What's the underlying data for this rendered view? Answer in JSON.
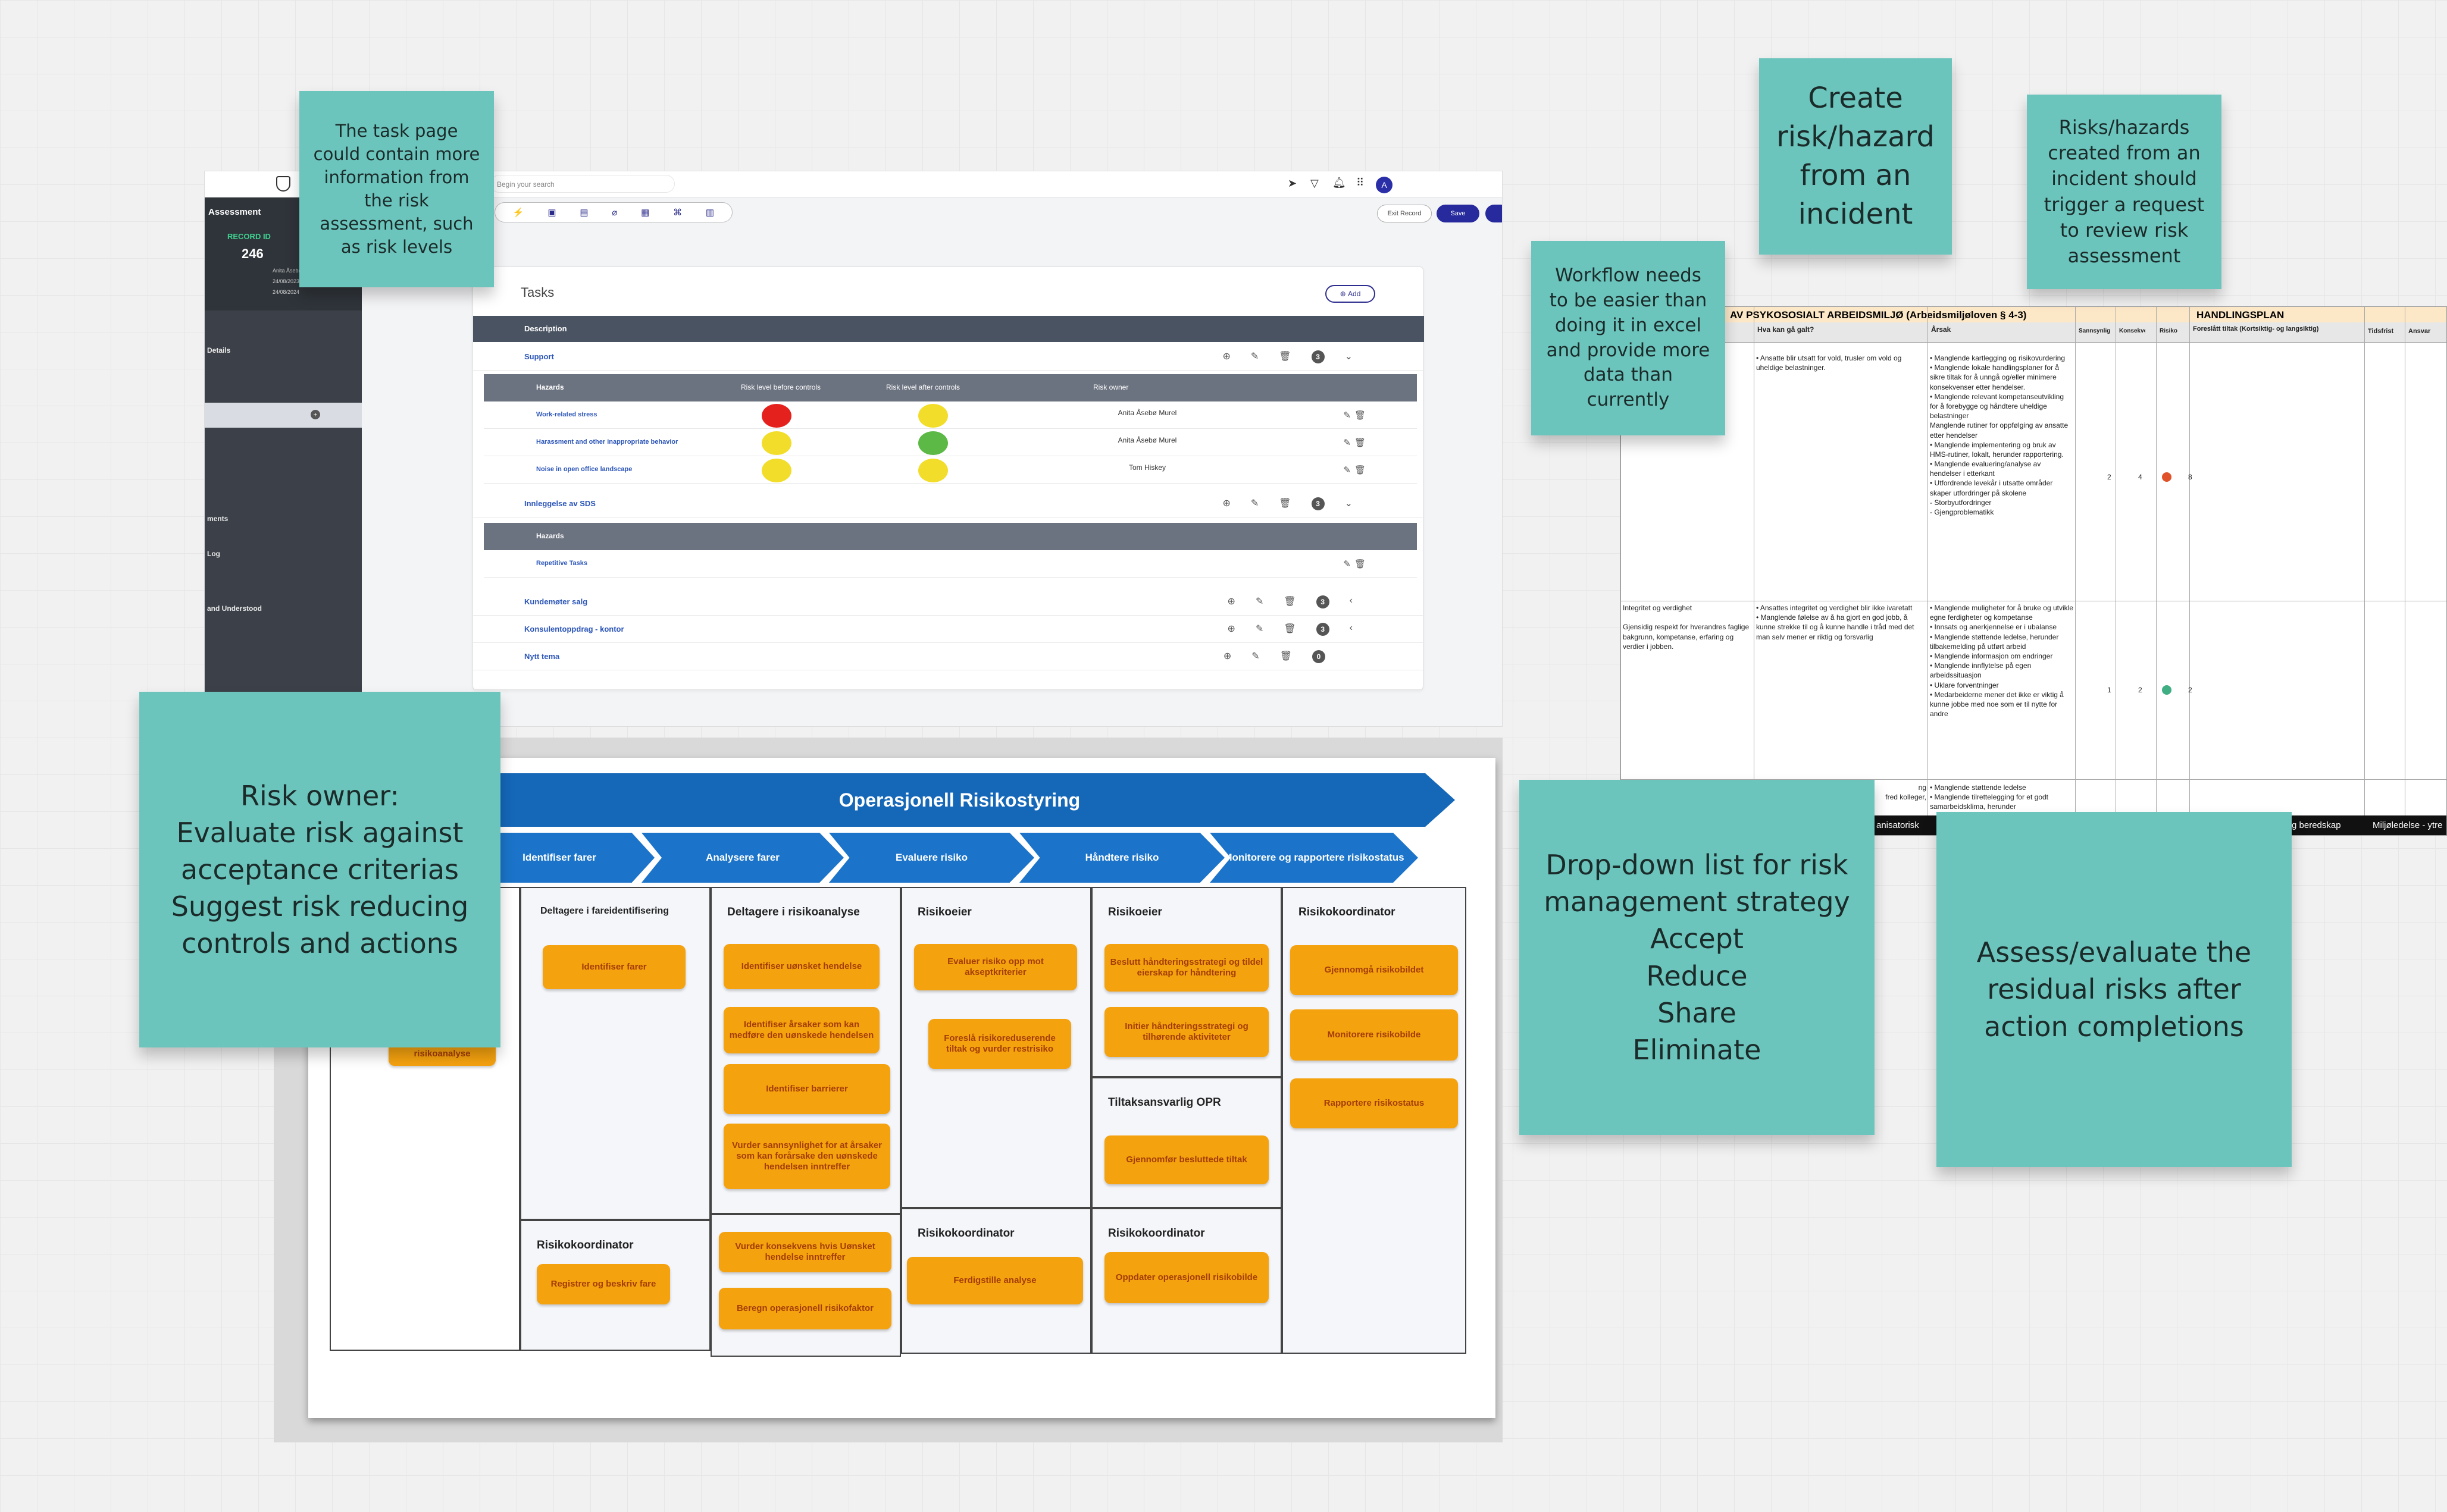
{
  "notes": {
    "task_page": "The task page could contain more information from the risk assessment, such as risk levels",
    "create_risk": "Create risk/hazard from an incident",
    "trigger_review": "Risks/hazards created from an incident should trigger a request to review risk assessment",
    "workflow": "Workflow needs to be easier than doing it in excel and provide more data than currently",
    "risk_owner": "Risk owner:\nEvaluate risk against acceptance criterias\nSuggest risk reducing controls and actions",
    "dropdown": "Drop-down list for risk management strategy\nAccept\nReduce\nShare\nEliminate",
    "assess": "Assess/evaluate the residual risks after action completions"
  },
  "app": {
    "search_placeholder": "Begin your search",
    "avatar": "A",
    "sidebar": {
      "title": "Assessment",
      "record_label": "RECORD ID",
      "record_id": "246",
      "owner": "Anita Åsebø Murel",
      "date1": "24/08/2023",
      "date2": "24/08/2024",
      "labels": [
        "Details",
        "ments",
        "Log",
        "and Understood"
      ]
    },
    "exit_label": "Exit Record",
    "save_label": "Save",
    "tasks_title": "Tasks",
    "add_label": "Add",
    "desc_header": "Description",
    "rows": [
      {
        "name": "Support"
      },
      {
        "name": "Innleggelse av SDS"
      },
      {
        "name": "Kundemøter salg"
      },
      {
        "name": "Konsulentoppdrag - kontor"
      },
      {
        "name": "Nytt tema"
      }
    ],
    "hazard_headers": {
      "hazards": "Hazards",
      "before": "Risk level before controls",
      "after": "Risk level after controls",
      "owner": "Risk owner"
    },
    "hazards": [
      {
        "name": "Work-related stress",
        "before": "#e5211d",
        "after": "#f2dd2a",
        "owner": "Anita Åsebø Murel"
      },
      {
        "name": "Harassment and other inappropriate behavior",
        "before": "#f2dd2a",
        "after": "#5cb946",
        "owner": "Anita Åsebø Murel"
      },
      {
        "name": "Noise in open office landscape",
        "before": "#f2dd2a",
        "after": "#f2dd2a",
        "owner": "Tom Hiskey"
      }
    ],
    "hazards2_header": "Hazards",
    "hazards2": [
      {
        "name": "Repetitive Tasks"
      }
    ]
  },
  "process": {
    "title": "Operasjonell Risikostyring",
    "phases": [
      "Identifiser farer",
      "Analysere farer",
      "Evaluere risiko",
      "Håndtere risiko",
      "Monitorere og rapportere risikostatus"
    ],
    "col1_hidden": "risikoanalyse",
    "ident": {
      "head": "Deltagere i fareidentifisering",
      "box": "Identifiser farer"
    },
    "analysis": {
      "head": "Deltagere i risikoanalyse",
      "boxes": [
        "Identifiser uønsket hendelse",
        "Identifiser årsaker som kan medføre den uønskede hendelsen",
        "Identifiser barrierer",
        "Vurder sannsynlighet for at årsaker som kan forårsake den uønskede hendelsen inntreffer"
      ],
      "boxes2": [
        "Vurder konsekvens hvis Uønsket hendelse inntreffer",
        "Beregn operasjonell risikofaktor"
      ]
    },
    "evaluate": {
      "head": "Risikoeier",
      "boxes": [
        "Evaluer risiko opp mot akseptkriterier",
        "Foreslå risikoreduserende tiltak og vurder restrisiko"
      ],
      "head2": "Risikokoordinator",
      "box2": "Ferdigstille analyse"
    },
    "handle": {
      "head": "Risikoeier",
      "boxes": [
        "Beslutt håndteringsstrategi og tildel eierskap for håndtering",
        "Initier håndteringsstrategi og tilhørende aktiviteter"
      ],
      "head2": "Tiltaksansvarlig OPR",
      "box2": "Gjennomfør besluttede tiltak",
      "head3": "Risikokoordinator",
      "box3": "Oppdater operasjonell risikobilde"
    },
    "monitor": {
      "head": "Risikokoordinator",
      "boxes": [
        "Gjennomgå risikobildet",
        "Monitorere risikobilde",
        "Rapportere risikostatus"
      ]
    },
    "register": {
      "head": "Risikokoordinator",
      "box": "Registrer og beskriv fare"
    }
  },
  "sheet": {
    "title_left": "AV PSYKOSOSIALT ARBEIDSMILJØ (Arbeidsmiljøloven § 4-3)",
    "title_right": "HANDLINGSPLAN",
    "headers": [
      "Hva kan gå galt?",
      "Årsak",
      "Sannsynlig",
      "Konsekvens",
      "Risiko",
      "Foreslått tiltak (Kortsiktig- og langsiktig)",
      "Tidsfrist",
      "Ansvar"
    ],
    "row1": {
      "what": "• Ansatte blir utsatt for vold, trusler om vold og uheldige belastninger.",
      "cause": "• Manglende kartlegging og risikovurdering\n• Manglende lokale handlingsplaner for å sikre tiltak for å unngå og/eller minimere konsekvenser etter hendelser.\n• Manglende relevant kompetanseutvikling for å forebygge og håndtere uheldige belastninger\nManglende rutiner for oppfølging av ansatte etter hendelser\n• Manglende implementering og bruk av HMS-rutiner, lokalt, herunder rapportering.\n• Manglende evaluering/analyse av hendelser i etterkant\n• Utfordrende levekår i utsatte områder skaper utfordringer på skolene\n- Storbyutfordringer\n- Gjengproblematikk",
      "prob": "2",
      "cons": "4",
      "risk": "8",
      "dot": "#e0522a"
    },
    "row2": {
      "topic": "Integritet og verdighet\n\nGjensidig respekt for hverandres faglige bakgrunn, kompetanse, erfaring og verdier i jobben.",
      "what": "• Ansattes integritet og verdighet blir ikke ivaretatt\n• Manglende følelse av å ha gjort en god jobb, å kunne strekke til og å kunne handle i tråd med det man selv mener er riktig og forsvarlig",
      "cause": "• Manglende muligheter for å bruke og utvikle egne ferdigheter og kompetanse\n• Innsats og anerkjennelse er i ubalanse\n• Manglende støttende ledelse, herunder tilbakemelding på utført arbeid\n• Manglende informasjon om endringer\n• Manglende innflytelse på egen arbeidssituasjon\n• Uklare forventninger\n• Medarbeiderne mener det ikke er viktig å kunne jobbe med noe som er til nytte for andre",
      "prob": "1",
      "cons": "2",
      "risk": "2",
      "dot": "#3fae82"
    },
    "row3_what": "ng\nfred kolleger,",
    "row3_cause": "• Manglende støttende ledelse\n• Manglende tilrettelegging for et godt samarbeidsklima, herunder",
    "tabs": [
      "anisatorisk",
      "g beredskap",
      "Miljøledelse - ytre"
    ]
  }
}
